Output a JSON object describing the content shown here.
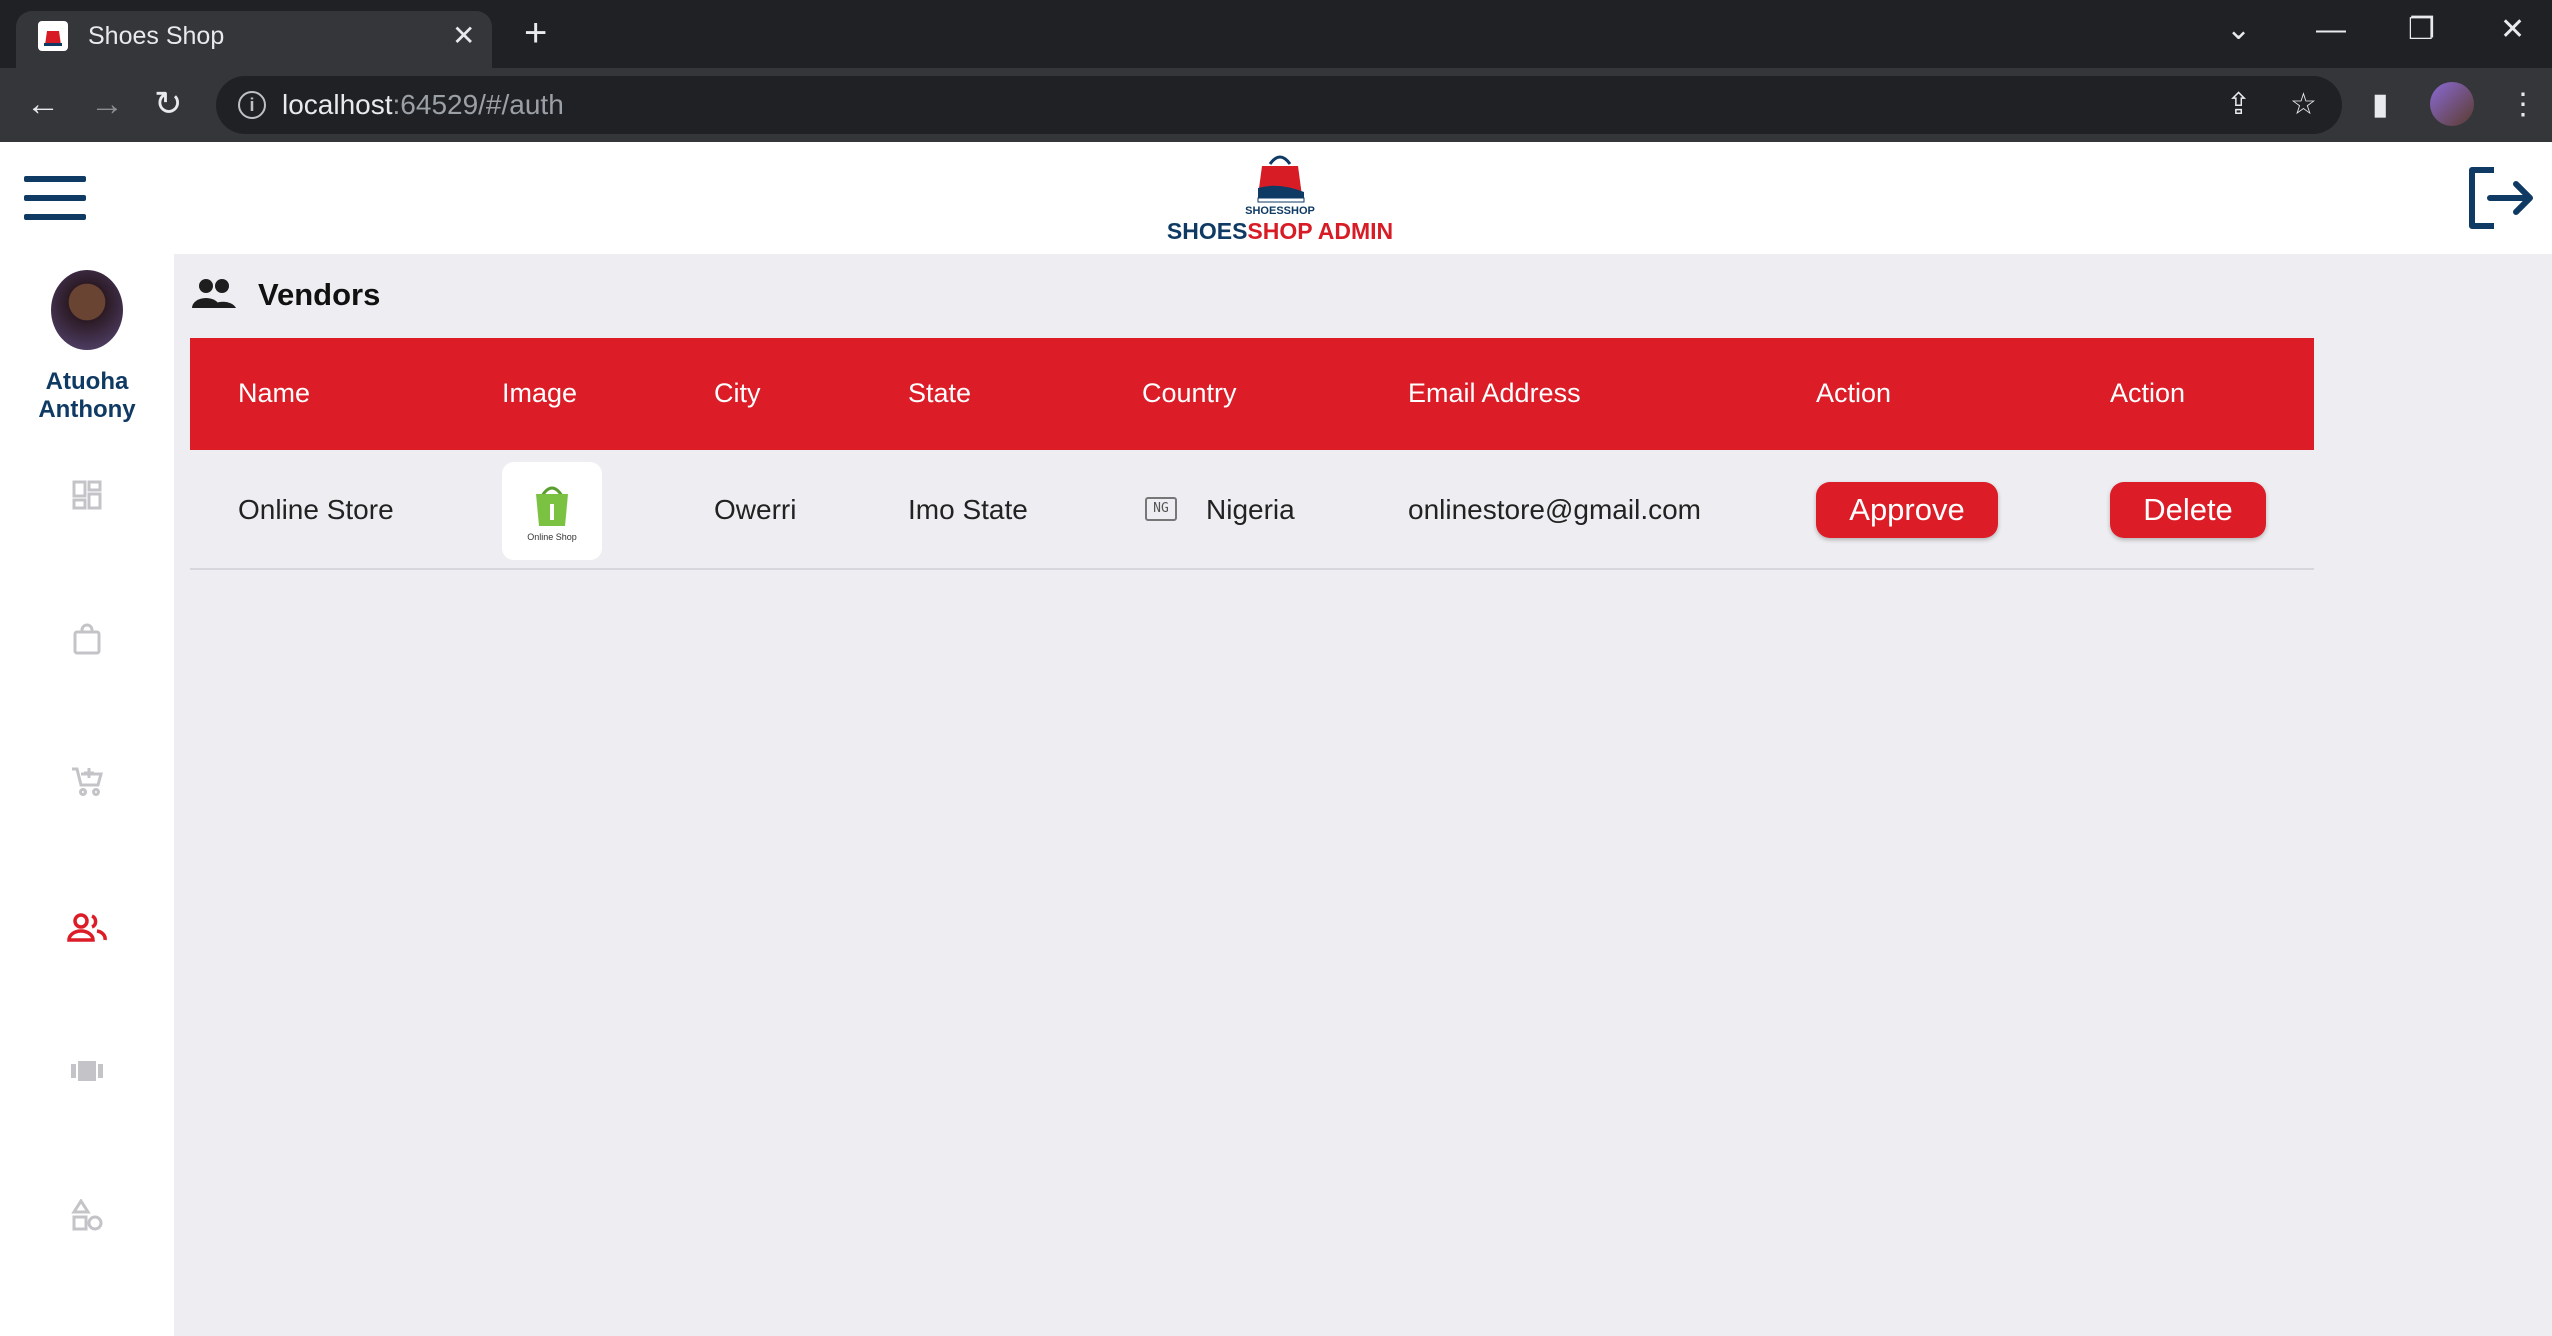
{
  "browser": {
    "tab_title": "Shoes Shop",
    "url_host": "localhost",
    "url_rest": ":64529/#/auth"
  },
  "header": {
    "logo_caption": "SHOESSHOP",
    "brand_primary": "SHOES",
    "brand_secondary": "SHOP ADMIN"
  },
  "sidebar": {
    "user_name": "Atuoha Anthony",
    "items": [
      {
        "icon": "dashboard-icon",
        "active": false
      },
      {
        "icon": "shopping-bag-icon",
        "active": false
      },
      {
        "icon": "add-cart-icon",
        "active": false
      },
      {
        "icon": "vendors-icon",
        "active": true
      },
      {
        "icon": "carousel-icon",
        "active": false
      },
      {
        "icon": "categories-icon",
        "active": false
      }
    ]
  },
  "page": {
    "title": "Vendors",
    "icon": "people-icon"
  },
  "table": {
    "columns": [
      "Name",
      "Image",
      "City",
      "State",
      "Country",
      "Email Address",
      "Action",
      "Action"
    ],
    "rows": [
      {
        "name": "Online Store",
        "image_caption": "Online Shop",
        "city": "Owerri",
        "state": "Imo State",
        "country_code": "NG",
        "country": "Nigeria",
        "email": "onlinestore@gmail.com",
        "approve_label": "Approve",
        "delete_label": "Delete"
      }
    ]
  },
  "colors": {
    "accent_red": "#dc1c26",
    "brand_navy": "#0f3a63",
    "page_bg": "#eeeef2"
  }
}
